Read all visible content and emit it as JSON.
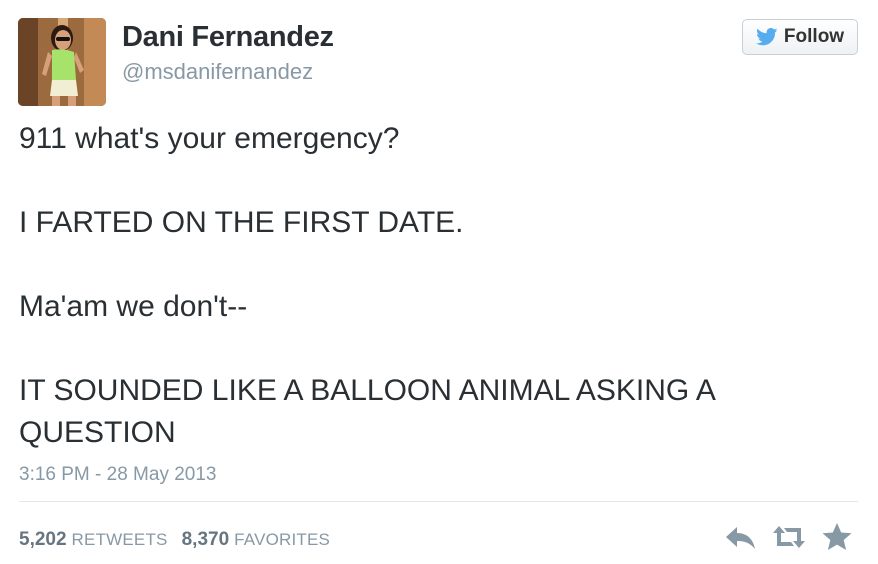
{
  "user": {
    "name": "Dani Fernandez",
    "handle": "@msdanifernandez"
  },
  "follow_button": {
    "label": "Follow",
    "icon": "twitter-bird-icon",
    "icon_color": "#55acee"
  },
  "tweet": {
    "lines": [
      "911 what's your emergency?",
      "I FARTED ON THE FIRST DATE.",
      "Ma'am we don't--",
      "IT SOUNDED LIKE A BALLOON ANIMAL ASKING A QUESTION"
    ],
    "timestamp": "3:16 PM - 28 May 2013"
  },
  "stats": {
    "retweets_count": "5,202",
    "retweets_label": "RETWEETS",
    "favorites_count": "8,370",
    "favorites_label": "FAVORITES"
  },
  "actions": [
    "reply-icon",
    "retweet-icon",
    "favorite-star-icon"
  ],
  "colors": {
    "text": "#292f33",
    "muted": "#8899a6",
    "icon": "#8899a6"
  }
}
